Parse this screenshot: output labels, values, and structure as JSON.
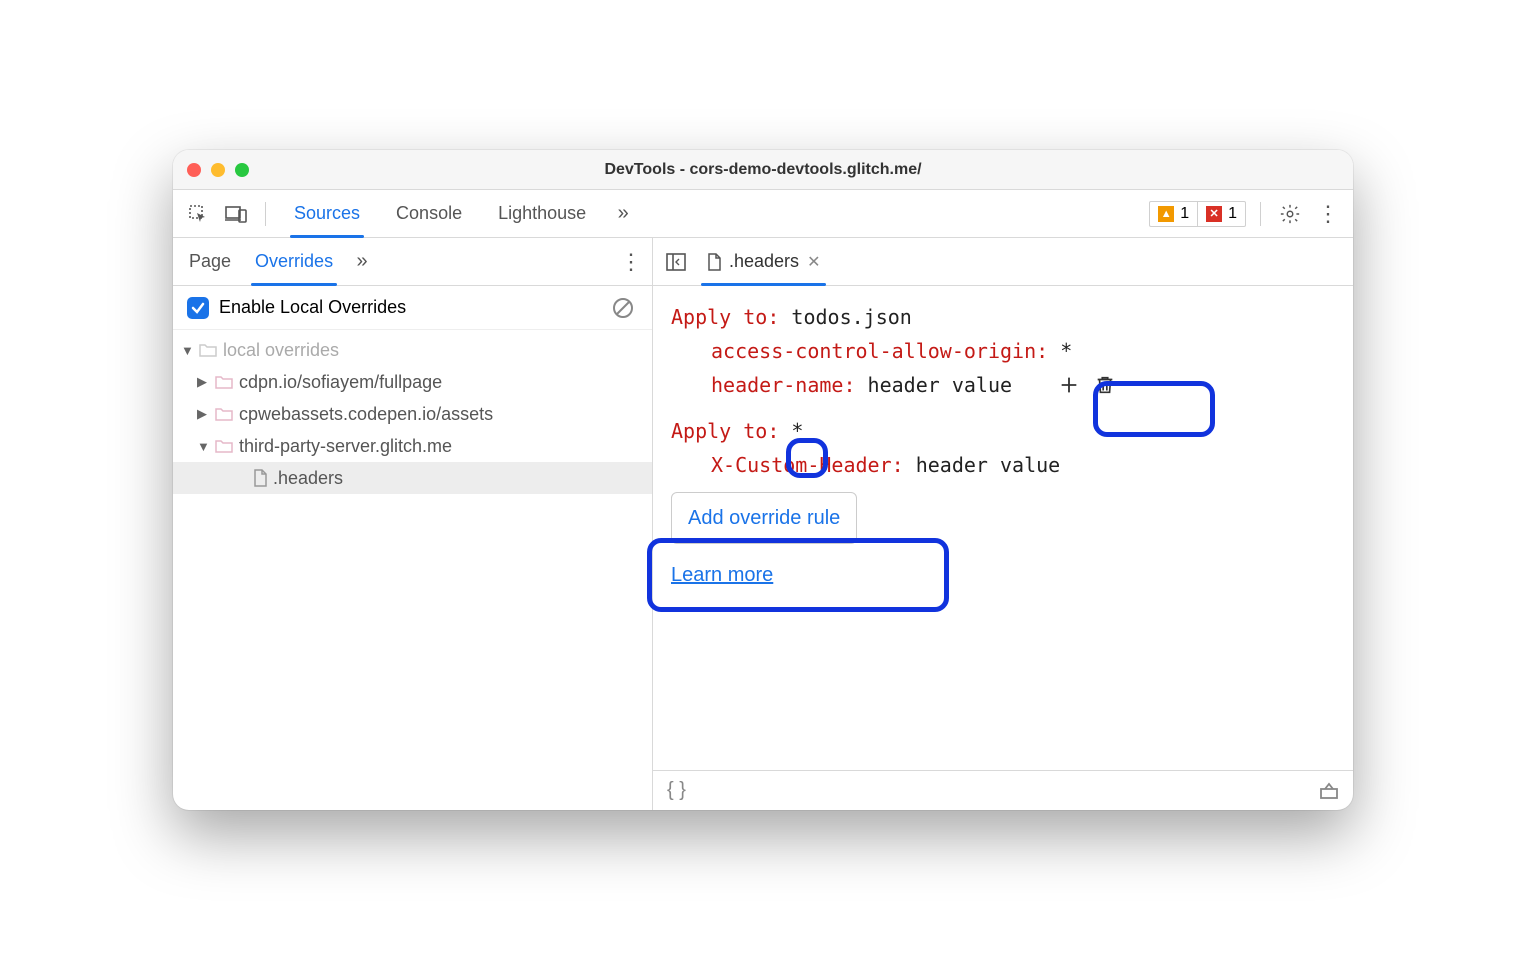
{
  "window": {
    "title": "DevTools - cors-demo-devtools.glitch.me/"
  },
  "main_tabs": {
    "sources": "Sources",
    "console": "Console",
    "lighthouse": "Lighthouse"
  },
  "badges": {
    "warnings": "1",
    "errors": "1"
  },
  "left_tabs": {
    "page": "Page",
    "overrides": "Overrides"
  },
  "enable_overrides_label": "Enable Local Overrides",
  "tree": {
    "root": "local overrides",
    "folder1": "cdpn.io/sofiayem/fullpage",
    "folder2": "cpwebassets.codepen.io/assets",
    "folder3": "third-party-server.glitch.me",
    "file": ".headers"
  },
  "file_tab": {
    "name": ".headers"
  },
  "editor": {
    "apply_label": "Apply to",
    "rule1_target": "todos.json",
    "rule1_h1_name": "access-control-allow-origin",
    "rule1_h1_val": "*",
    "rule1_h2_name": "header-name",
    "rule1_h2_val": "header value",
    "rule2_target": "*",
    "rule2_h1_name": "X-Custom-Header",
    "rule2_h1_val": "header value",
    "add_rule": "Add override rule",
    "learn_more": "Learn more"
  }
}
